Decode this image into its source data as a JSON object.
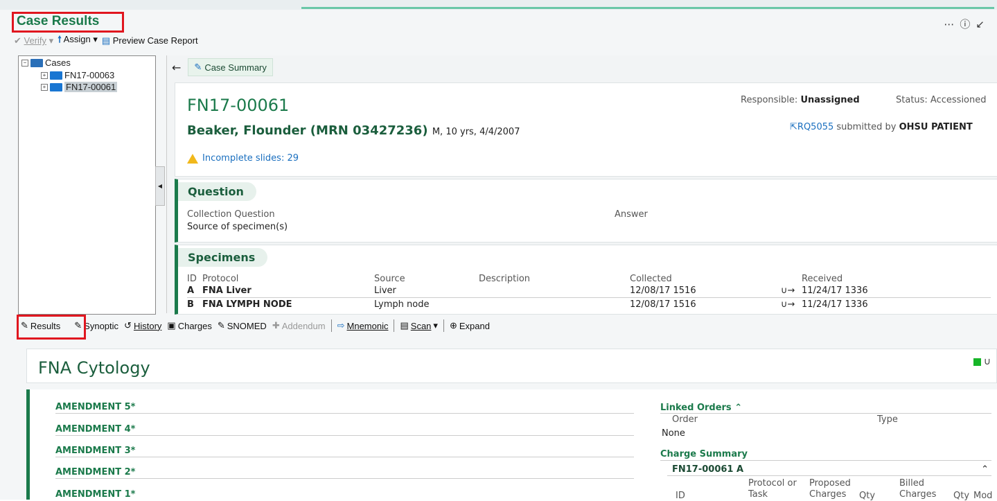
{
  "app": {
    "title": "Case Results"
  },
  "toolbar1": {
    "verify": "Verify",
    "assign": "Assign",
    "preview": "Preview Case Report"
  },
  "tree": {
    "root": "Cases",
    "items": [
      {
        "label": "FN17-00063"
      },
      {
        "label": "FN17-00061"
      }
    ]
  },
  "summary": {
    "tab_label": "Case Summary"
  },
  "case": {
    "id": "FN17-00061",
    "patient_name": "Beaker, Flounder (MRN 03427236)",
    "patient_details": "M, 10 yrs, 4/4/2007",
    "responsible_label": "Responsible:",
    "responsible_value": "Unassigned",
    "status": "Status: Accessioned",
    "rq_link": "RQ5055",
    "rq_submitted": "submitted by",
    "rq_by": "OHSU PATIENT",
    "incomplete": "Incomplete slides: 29"
  },
  "question": {
    "title": "Question",
    "col_question": "Collection Question",
    "col_answer": "Answer",
    "row": "Source of specimen(s)"
  },
  "specimens": {
    "title": "Specimens",
    "headers": {
      "id": "ID",
      "protocol": "Protocol",
      "source": "Source",
      "description": "Description",
      "collected": "Collected",
      "received": "Received"
    },
    "rows": [
      {
        "id": "A",
        "protocol": "FNA Liver",
        "source": "Liver",
        "description": "",
        "collected": "12/08/17 1516",
        "received": "11/24/17 1336"
      },
      {
        "id": "B",
        "protocol": "FNA LYMPH NODE",
        "source": "Lymph node",
        "description": "",
        "collected": "12/08/17 1516",
        "received": "11/24/17 1336"
      }
    ]
  },
  "toolbar2": {
    "results": "Results",
    "synoptic": "Synoptic",
    "history": "History",
    "charges": "Charges",
    "snomed": "SNOMED",
    "addendum": "Addendum",
    "mnemonic": "Mnemonic",
    "scan": "Scan",
    "expand": "Expand"
  },
  "report": {
    "title": "FNA Cytology"
  },
  "amendments": [
    "AMENDMENT 5*",
    "AMENDMENT 4*",
    "AMENDMENT 3*",
    "AMENDMENT 2*",
    "AMENDMENT 1*"
  ],
  "linked_orders": {
    "title": "Linked Orders",
    "col_order": "Order",
    "col_type": "Type",
    "value": "None"
  },
  "charge_summary": {
    "title": "Charge Summary",
    "case_row": "FN17-00061 A",
    "headers": {
      "id": "ID",
      "protocol": "Protocol or Task",
      "proposed": "Proposed Charges",
      "qty": "Qty",
      "billed": "Billed Charges",
      "qty2": "Qty",
      "mod": "Mod"
    }
  },
  "colors": {
    "brand_green": "#1b7a4b",
    "link_blue": "#1a6fbf",
    "highlight_red": "#e0161f",
    "status_green": "#17b528",
    "warning_yellow": "#f1b81b"
  }
}
